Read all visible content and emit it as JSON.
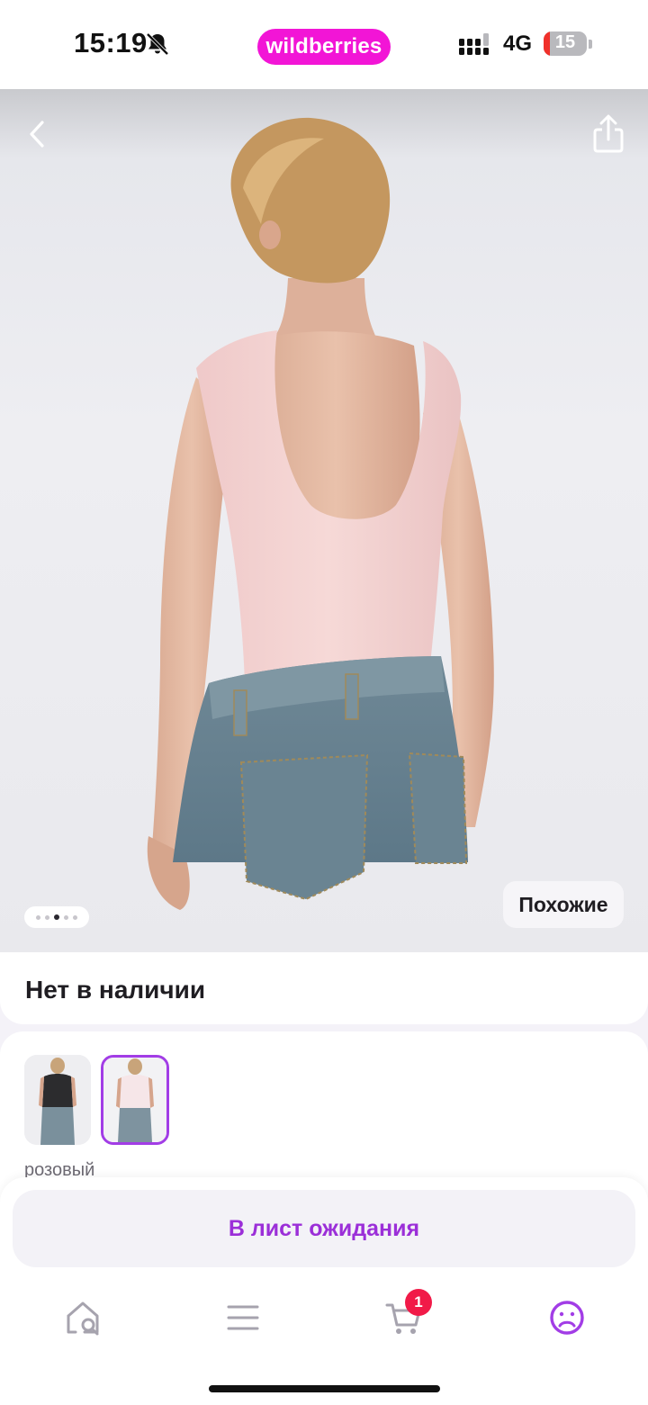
{
  "status_bar": {
    "time": "15:19",
    "network": "4G",
    "battery_level": "15",
    "battery_fraction": 0.15,
    "icons": [
      "bell-off-icon",
      "signal-icon",
      "battery-icon"
    ]
  },
  "header": {
    "brand": "wildberries",
    "brand_color": "#f215d6"
  },
  "hero": {
    "icons": [
      "back-arrow-icon",
      "share-icon"
    ],
    "similar_label": "Похожие",
    "carousel_dots": 5,
    "carousel_active_index": 2
  },
  "product": {
    "availability": "Нет в наличии",
    "colors": [
      "черный-thumbnail",
      "розовый-thumbnail"
    ],
    "selected_color": "розовый",
    "accent_color": "#a23de6"
  },
  "actions": {
    "waitlist_label": "В лист ожидания"
  },
  "bottom_nav": {
    "items": [
      "home-search-icon",
      "catalog-icon",
      "cart-icon",
      "profile-icon"
    ],
    "cart_badge": "1",
    "active_item": "profile-icon"
  }
}
